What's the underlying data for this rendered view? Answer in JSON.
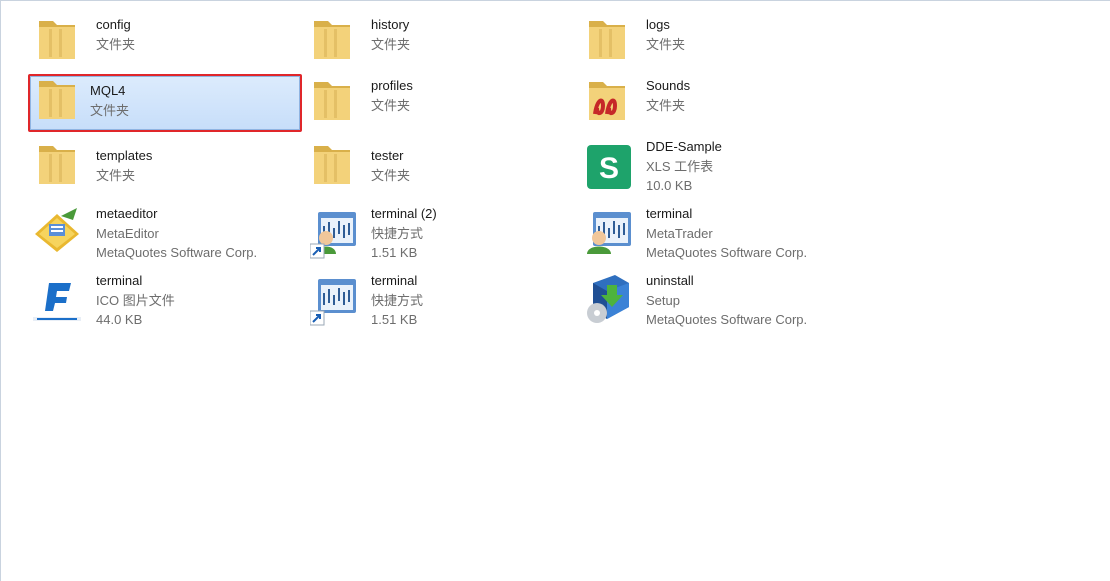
{
  "selected_item": "MQL4",
  "items": [
    {
      "name": "config",
      "line1": "文件夹",
      "icon": "folder-icon"
    },
    {
      "name": "history",
      "line1": "文件夹",
      "icon": "folder-icon"
    },
    {
      "name": "logs",
      "line1": "文件夹",
      "icon": "folder-icon"
    },
    {
      "name": "MQL4",
      "line1": "文件夹",
      "icon": "folder-icon"
    },
    {
      "name": "profiles",
      "line1": "文件夹",
      "icon": "folder-icon"
    },
    {
      "name": "Sounds",
      "line1": "文件夹",
      "icon": "sounds-folder-icon"
    },
    {
      "name": "templates",
      "line1": "文件夹",
      "icon": "folder-icon"
    },
    {
      "name": "tester",
      "line1": "文件夹",
      "icon": "folder-icon"
    },
    {
      "name": "DDE-Sample",
      "line1": "XLS 工作表",
      "line2": "10.0 KB",
      "icon": "spreadsheet-icon",
      "icon_letter": "S"
    },
    {
      "name": "metaeditor",
      "line1": "MetaEditor",
      "line2": "MetaQuotes Software Corp.",
      "icon": "metaeditor-icon"
    },
    {
      "name": "terminal (2)",
      "line1": "快捷方式",
      "line2": "1.51 KB",
      "icon": "terminal-shortcut-icon"
    },
    {
      "name": "terminal",
      "line1": "MetaTrader",
      "line2": "MetaQuotes Software Corp.",
      "icon": "terminal-app-icon"
    },
    {
      "name": "terminal",
      "line1": "ICO 图片文件",
      "line2": "44.0 KB",
      "icon": "ico-image-icon",
      "icon_letter": "F"
    },
    {
      "name": "terminal",
      "line1": "快捷方式",
      "line2": "1.51 KB",
      "icon": "terminal-shortcut-icon"
    },
    {
      "name": "uninstall",
      "line1": "Setup",
      "line2": "MetaQuotes Software Corp.",
      "icon": "uninstall-icon"
    }
  ],
  "colors": {
    "folder": "#f3d27a",
    "folder_dark": "#d9b04a",
    "selection_bg": "#cfe3fb",
    "highlight_frame": "#e0262a",
    "spreadsheet": "#1ea36b"
  }
}
